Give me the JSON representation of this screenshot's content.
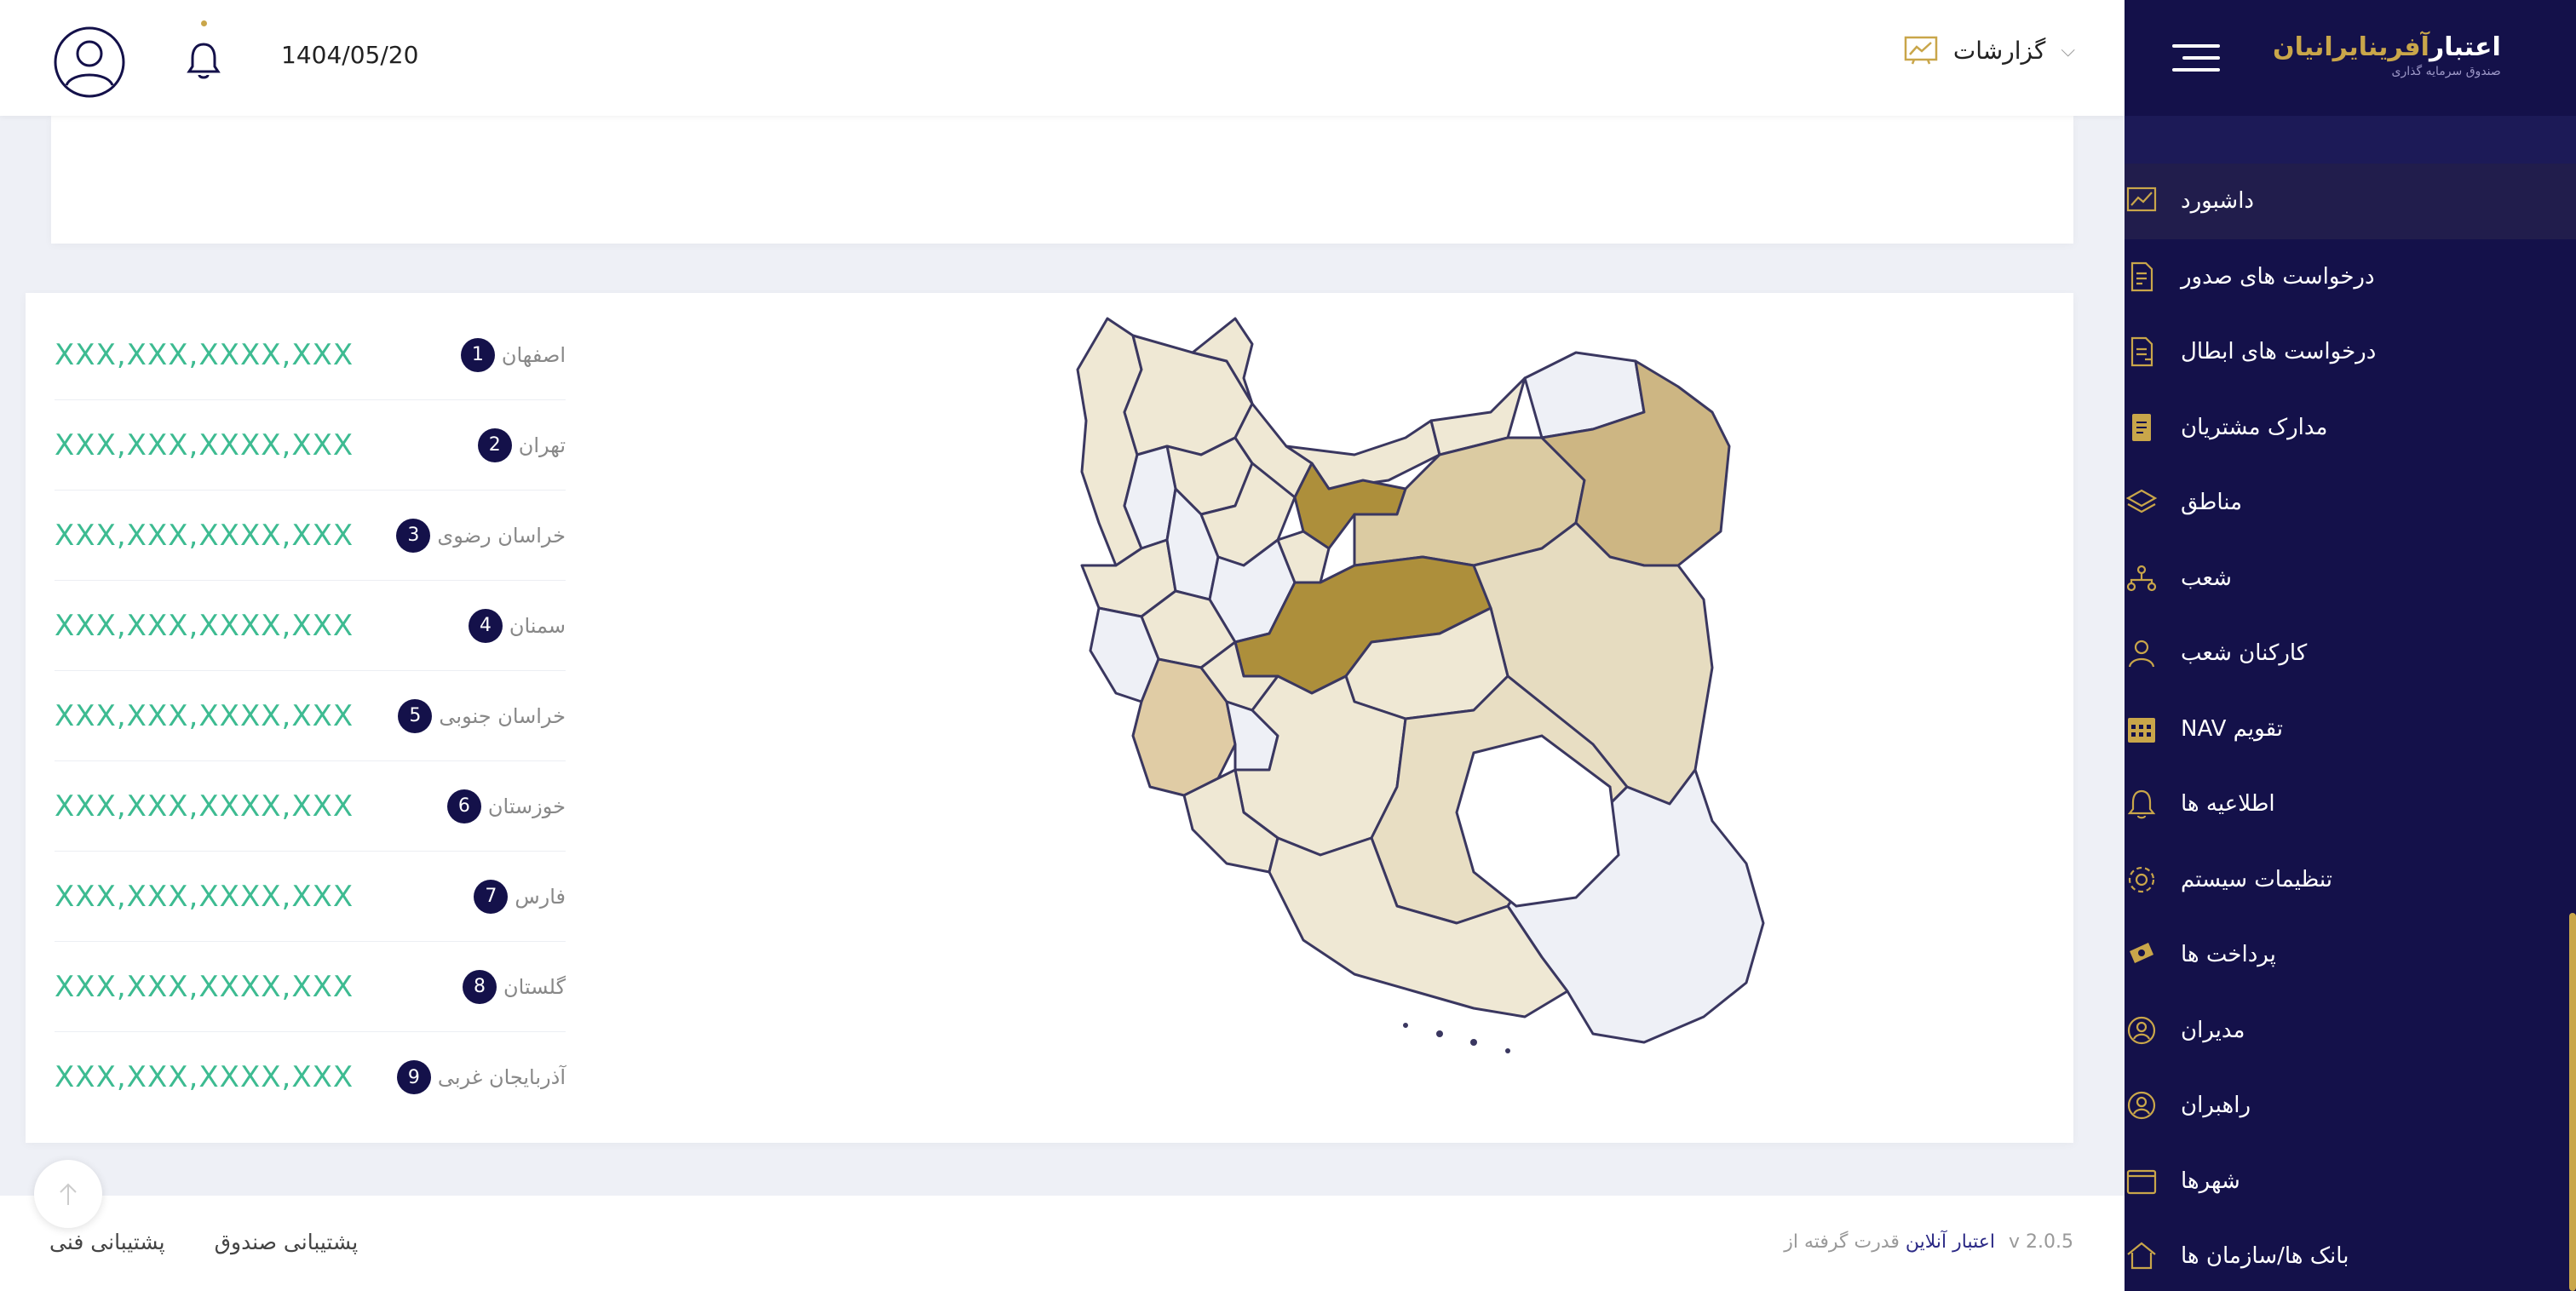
{
  "topbar": {
    "date": "1404/05/20",
    "reports_label": "گزارشات",
    "reports_chevron": "⌵"
  },
  "sidebar": {
    "logo": {
      "title_part1": "اعتبار",
      "title_part2": "آفرین",
      "title_part3": "ایرانیان",
      "subtitle": "صندوق سرمایه گذاری"
    },
    "items": [
      {
        "label": "داشبورد",
        "icon": "chart-icon",
        "active": true
      },
      {
        "label": "درخواست های صدور",
        "icon": "document-add-icon"
      },
      {
        "label": "درخواست های ابطال",
        "icon": "document-remove-icon"
      },
      {
        "label": "مدارک مشتریان",
        "icon": "id-card-icon"
      },
      {
        "label": "مناطق",
        "icon": "layers-icon"
      },
      {
        "label": "شعب",
        "icon": "branch-icon"
      },
      {
        "label": "کارکنان شعب",
        "icon": "staff-icon"
      },
      {
        "label": "تقویم NAV",
        "icon": "calendar-icon"
      },
      {
        "label": "اطلاعیه ها",
        "icon": "bell-icon"
      },
      {
        "label": "تنظیمات سیستم",
        "icon": "gear-icon"
      },
      {
        "label": "پرداخت ها",
        "icon": "payment-icon"
      },
      {
        "label": "مدیران",
        "icon": "manager-icon"
      },
      {
        "label": "راهبران",
        "icon": "leader-icon"
      },
      {
        "label": "شهرها",
        "icon": "city-icon"
      },
      {
        "label": "بانک ها/سازمان ها",
        "icon": "bank-icon"
      }
    ]
  },
  "ranking": [
    {
      "rank": "1",
      "name": "اصفهان",
      "value": "XXX,XXX,XXXX,XXX"
    },
    {
      "rank": "2",
      "name": "تهران",
      "value": "XXX,XXX,XXXX,XXX"
    },
    {
      "rank": "3",
      "name": "خراسان رضوی",
      "value": "XXX,XXX,XXXX,XXX"
    },
    {
      "rank": "4",
      "name": "سمنان",
      "value": "XXX,XXX,XXXX,XXX"
    },
    {
      "rank": "5",
      "name": "خراسان جنوبی",
      "value": "XXX,XXX,XXXX,XXX"
    },
    {
      "rank": "6",
      "name": "خوزستان",
      "value": "XXX,XXX,XXXX,XXX"
    },
    {
      "rank": "7",
      "name": "فارس",
      "value": "XXX,XXX,XXXX,XXX"
    },
    {
      "rank": "8",
      "name": "گلستان",
      "value": "XXX,XXX,XXXX,XXX"
    },
    {
      "rank": "9",
      "name": "آذربایجان غربی",
      "value": "XXX,XXX,XXXX,XXX"
    }
  ],
  "footer": {
    "support_tech": "پشتیبانی فنی",
    "support_fund": "پشتیبانی صندوق",
    "version": "v 2.0.5",
    "powered_by": "قدرت گرفته از",
    "powered_link": "اعتبار آنلاین"
  },
  "colors": {
    "sidebar_bg": "#14114a",
    "accent_gold": "#c9a64a",
    "value_green": "#3dbb91",
    "map_top": "#ad8f3b",
    "map_high": "#cdb683",
    "map_mid": "#d9c9a0",
    "map_low": "#e6dcc0",
    "map_light": "#f0e9d6",
    "map_none": "#eef0f6"
  }
}
